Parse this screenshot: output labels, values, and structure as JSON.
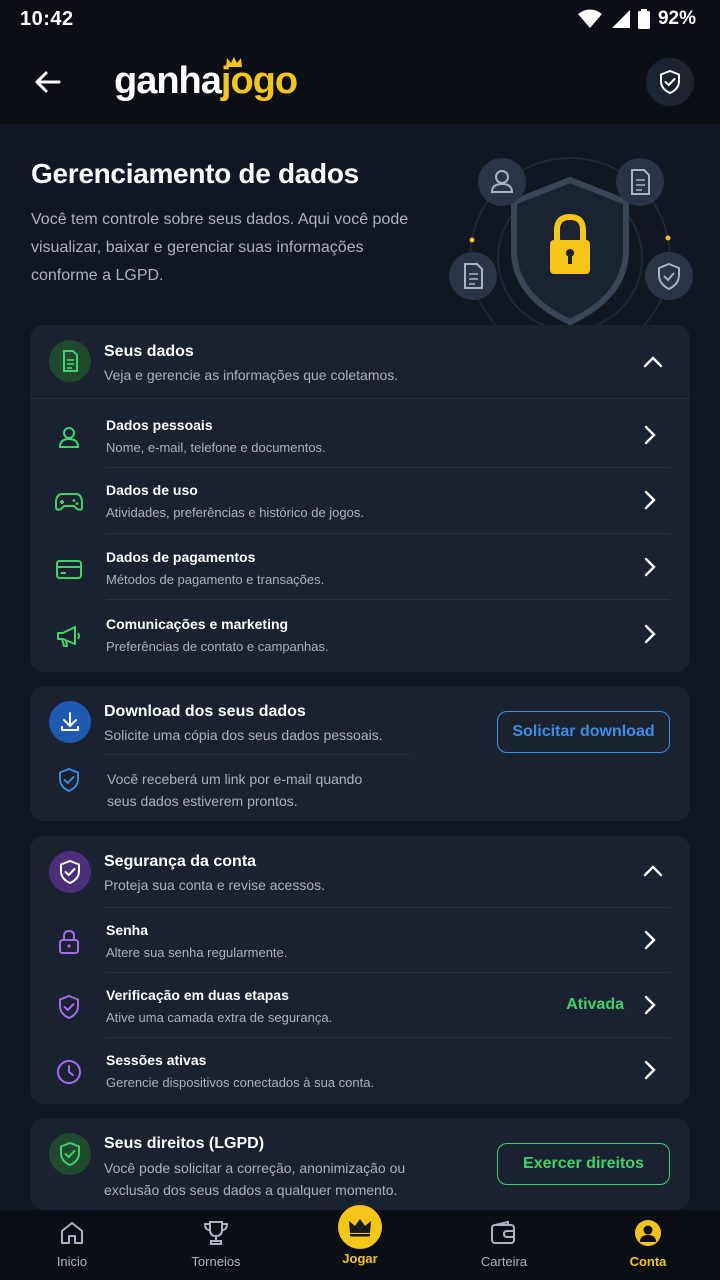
{
  "status_bar": {
    "time": "10:42",
    "battery": "92%"
  },
  "header": {
    "logo_part1": "ganha",
    "logo_part2": "jogo"
  },
  "hero": {
    "title": "Gerenciamento de dados",
    "description": "Você tem controle sobre seus dados. Aqui você pode visualizar, baixar e gerenciar suas informações conforme a LGPD."
  },
  "seus_dados": {
    "title": "Seus dados",
    "subtitle": "Veja e gerencie as informações que coletamos.",
    "items": [
      {
        "title": "Dados pessoais",
        "subtitle": "Nome, e-mail, telefone e documentos."
      },
      {
        "title": "Dados de uso",
        "subtitle": "Atividades, preferências e histórico de jogos."
      },
      {
        "title": "Dados de pagamentos",
        "subtitle": "Métodos de pagamento e transações."
      },
      {
        "title": "Comunicações e marketing",
        "subtitle": "Preferências de contato e campanhas."
      }
    ]
  },
  "download": {
    "title": "Download dos seus dados",
    "subtitle": "Solicite uma cópia dos seus dados pessoais.",
    "button": "Solicitar download",
    "note_line1": "Você receberá um link por e-mail quando",
    "note_line2": "seus dados estiverem prontos."
  },
  "seguranca": {
    "title": "Segurança da conta",
    "subtitle": "Proteja sua conta e revise acessos.",
    "items": [
      {
        "title": "Senha",
        "subtitle": "Altere sua senha regularmente."
      },
      {
        "title": "Verificação em duas etapas",
        "subtitle": "Ative uma camada extra de segurança.",
        "status": "Ativada"
      },
      {
        "title": "Sessões ativas",
        "subtitle": "Gerencie dispositivos conectados à sua conta."
      }
    ]
  },
  "direitos": {
    "title": "Seus direitos (LGPD)",
    "line1": "Você pode solicitar a correção, anonimização ou",
    "line2": "exclusão dos seus dados a qualquer momento.",
    "button": "Exercer direitos"
  },
  "nav": [
    {
      "label": "Inicio",
      "icon": "home-icon"
    },
    {
      "label": "Torneios",
      "icon": "trophy-icon"
    },
    {
      "label": "Jogar",
      "icon": "crown-icon"
    },
    {
      "label": "Carteira",
      "icon": "wallet-icon"
    },
    {
      "label": "Conta",
      "icon": "user-icon"
    }
  ],
  "colors": {
    "background": "#111722",
    "card": "#1a2230",
    "accent_yellow": "#f5c518",
    "green": "#3fd16b",
    "blue": "#3b8fe8",
    "purple": "#a56cf0"
  }
}
